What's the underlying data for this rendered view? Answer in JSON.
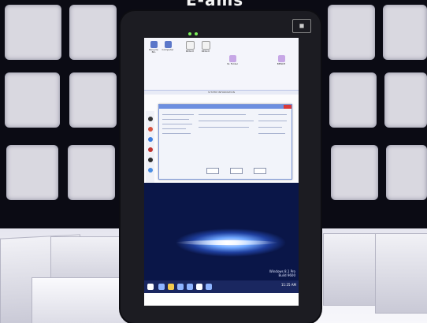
{
  "caption": "E-ams",
  "screen": {
    "explorer_title": "SYSTEM INFORMATION",
    "watermark_lines": [
      "Windows 8.1 Pro",
      "Build 9600"
    ],
    "clock": "11:25 AM"
  },
  "desktop_icons": [
    {
      "name": "recycle-bin-icon",
      "label": "Recycle Bin"
    },
    {
      "name": "computer-icon",
      "label": "Computer"
    },
    {
      "name": "folder-icon",
      "label": "BENCH"
    },
    {
      "name": "folder-icon",
      "label": "BENCH"
    },
    {
      "name": "folder-icon",
      "label": "S1 Folder"
    },
    {
      "name": "folder-icon",
      "label": "BENCH"
    }
  ],
  "colors": {
    "wall_panel": "#d9d8e0",
    "tablet_body": "#1c1c22",
    "led": "#7cf05a",
    "wallpaper_accent": "#6fa7ff"
  }
}
